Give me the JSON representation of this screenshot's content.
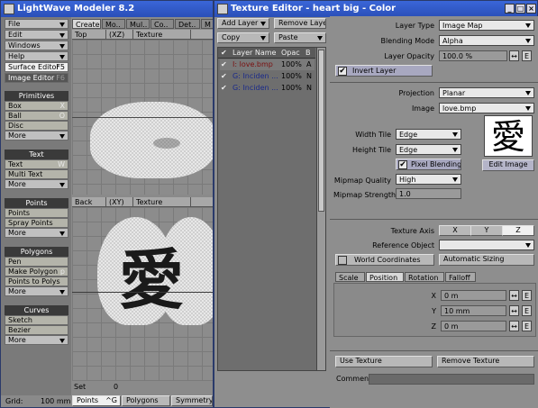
{
  "modeler": {
    "title": "LightWave Modeler 8.2",
    "menus": [
      "File",
      "Edit",
      "Windows",
      "Help"
    ],
    "surface_editor": {
      "label": "Surface Editor",
      "key": "F5"
    },
    "image_editor": {
      "label": "Image Editor",
      "key": "F6"
    },
    "tabs": [
      "Create",
      "Mo..",
      "Mul..",
      "Co..",
      "Det..",
      "M"
    ],
    "sections": {
      "primitives": {
        "header": "Primitives",
        "items": [
          {
            "label": "Box",
            "key": "X"
          },
          {
            "label": "Ball",
            "key": "O"
          },
          {
            "label": "Disc",
            "key": ""
          }
        ],
        "more": "More"
      },
      "text": {
        "header": "Text",
        "items": [
          {
            "label": "Text",
            "key": "W"
          },
          {
            "label": "Multi Text",
            "key": ""
          }
        ],
        "more": "More"
      },
      "points": {
        "header": "Points",
        "items": [
          {
            "label": "Points",
            "key": ""
          },
          {
            "label": "Spray Points",
            "key": ""
          }
        ],
        "more": "More"
      },
      "polygons": {
        "header": "Polygons",
        "items": [
          {
            "label": "Pen",
            "key": ""
          },
          {
            "label": "Make Polygon",
            "key": "p"
          },
          {
            "label": "Points to Polys",
            "key": ""
          }
        ],
        "more": "More"
      },
      "curves": {
        "header": "Curves",
        "items": [
          {
            "label": "Sketch",
            "key": ""
          },
          {
            "label": "Bezier",
            "key": ""
          }
        ],
        "more": "More"
      }
    },
    "viewport_top": {
      "view": "Top",
      "axes": "(XZ)",
      "mode": "Texture"
    },
    "viewport_back": {
      "view": "Back",
      "axes": "(XY)",
      "mode": "Texture"
    },
    "status": {
      "set_label": "Set",
      "set_value": "0",
      "grid_label": "Grid:",
      "grid_value": "100 mm",
      "points": "Points",
      "points_key": "^G",
      "polygons": "Polygons",
      "symmetry": "Symmetry"
    },
    "kanji": "愛"
  },
  "texture_editor": {
    "title": "Texture Editor - heart big - Color",
    "add_layer": "Add Layer",
    "remove_layer": "Remove Layer",
    "copy": "Copy",
    "paste": "Paste",
    "layer_columns": [
      "Layer Name",
      "Opac",
      "B"
    ],
    "layers": [
      {
        "name": "I: love.bmp",
        "opac": "100%",
        "blend": "A",
        "color": "#7a1010"
      },
      {
        "name": "G: Inciden ...",
        "opac": "100%",
        "blend": "N",
        "color": "#1a2a8a"
      },
      {
        "name": "G: Inciden ...",
        "opac": "100%",
        "blend": "N",
        "color": "#1a2a8a"
      }
    ],
    "layer_type_label": "Layer Type",
    "layer_type": "Image Map",
    "blending_mode_label": "Blending Mode",
    "blending_mode": "Alpha",
    "layer_opacity_label": "Layer Opacity",
    "layer_opacity": "100.0 %",
    "invert_layer": "Invert Layer",
    "projection_label": "Projection",
    "projection": "Planar",
    "image_label": "Image",
    "image": "love.bmp",
    "width_tile_label": "Width Tile",
    "width_tile": "Edge",
    "height_tile_label": "Height Tile",
    "height_tile": "Edge",
    "pixel_blending": "Pixel Blending",
    "edit_image": "Edit Image",
    "mipmap_quality_label": "Mipmap Quality",
    "mipmap_quality": "High",
    "mipmap_strength_label": "Mipmap Strength",
    "mipmap_strength": "1.0",
    "texture_axis_label": "Texture Axis",
    "axes": [
      "X",
      "Y",
      "Z"
    ],
    "reference_object_label": "Reference Object",
    "reference_object": "",
    "world_coordinates": "World Coordinates",
    "automatic_sizing": "Automatic Sizing",
    "tabs": [
      "Scale",
      "Position",
      "Rotation",
      "Falloff"
    ],
    "x_label": "X",
    "x_value": "0 m",
    "y_label": "Y",
    "y_value": "10 mm",
    "z_label": "Z",
    "z_value": "0 m",
    "e": "E",
    "use_texture": "Use Texture",
    "remove_texture": "Remove Texture",
    "comment_label": "Comment",
    "kanji": "愛"
  }
}
